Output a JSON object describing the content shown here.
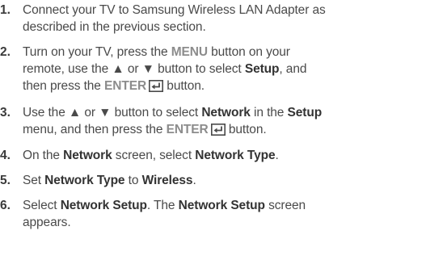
{
  "steps": [
    {
      "number": "1.",
      "line1": "Connect your TV to Samsung Wireless LAN Adapter as",
      "line2": "described in the previous section."
    },
    {
      "number": "2.",
      "t1": "Turn on your TV, press the ",
      "menu": "MENU",
      "t2": " button on your",
      "t3": "remote, use the ▲ or ▼ button to select ",
      "setup": "Setup",
      "t4": ", and",
      "t5": "then press the ",
      "enter": "ENTER",
      "t6": " button."
    },
    {
      "number": "3.",
      "t1": "Use the ▲ or ▼ button to select ",
      "network": "Network",
      "t2": " in the ",
      "setup": "Setup",
      "t3": "menu, and then press the ",
      "enter": "ENTER",
      "t4": " button."
    },
    {
      "number": "4.",
      "t1": "On the ",
      "network": "Network",
      "t2": " screen, select ",
      "network_type": "Network Type",
      "t3": "."
    },
    {
      "number": "5.",
      "t1": "Set ",
      "network_type": "Network Type",
      "t2": " to ",
      "wireless": "Wireless",
      "t3": "."
    },
    {
      "number": "6.",
      "t1": "Select ",
      "network_setup": "Network Setup",
      "t2": ". The ",
      "network_setup_2": "Network Setup",
      "t3": " screen",
      "t4": "appears."
    }
  ],
  "icons": {
    "enter": "enter-return-icon"
  },
  "colors": {
    "text": "#4a4a4a",
    "highlight": "#8c8c8c"
  }
}
